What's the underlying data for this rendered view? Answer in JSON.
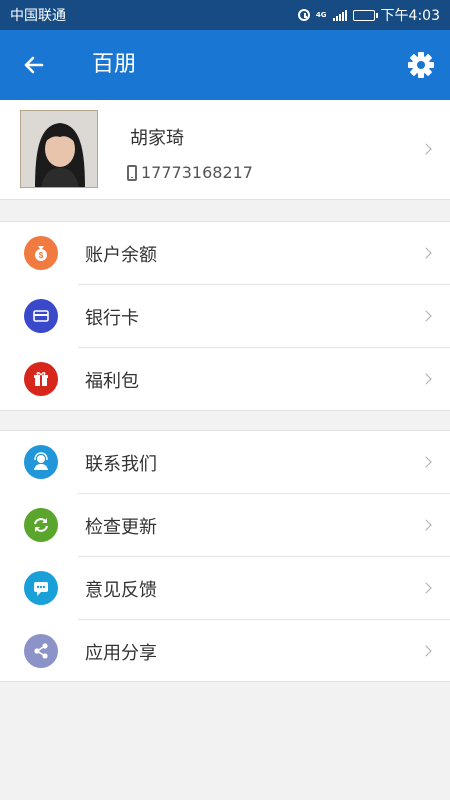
{
  "status_bar": {
    "carrier": "中国联通",
    "network": "4G",
    "time": "下午4:03"
  },
  "app_bar": {
    "title": "百朋",
    "back_icon": "arrow-left-icon",
    "settings_icon": "gear-icon"
  },
  "profile": {
    "name": "胡家琦",
    "phone": "17773168217"
  },
  "menu_groups": [
    {
      "items": [
        {
          "label": "账户余额",
          "icon": "money-bag-icon",
          "color": "#f07a3f"
        },
        {
          "label": "银行卡",
          "icon": "card-icon",
          "color": "#3949c9"
        },
        {
          "label": "福利包",
          "icon": "gift-icon",
          "color": "#d7261c"
        }
      ]
    },
    {
      "items": [
        {
          "label": "联系我们",
          "icon": "customer-service-icon",
          "color": "#2196d8"
        },
        {
          "label": "检查更新",
          "icon": "refresh-icon",
          "color": "#5aa52b"
        },
        {
          "label": "意见反馈",
          "icon": "chat-icon",
          "color": "#1aa0d8"
        },
        {
          "label": "应用分享",
          "icon": "share-icon",
          "color": "#8c93c9"
        }
      ]
    }
  ]
}
